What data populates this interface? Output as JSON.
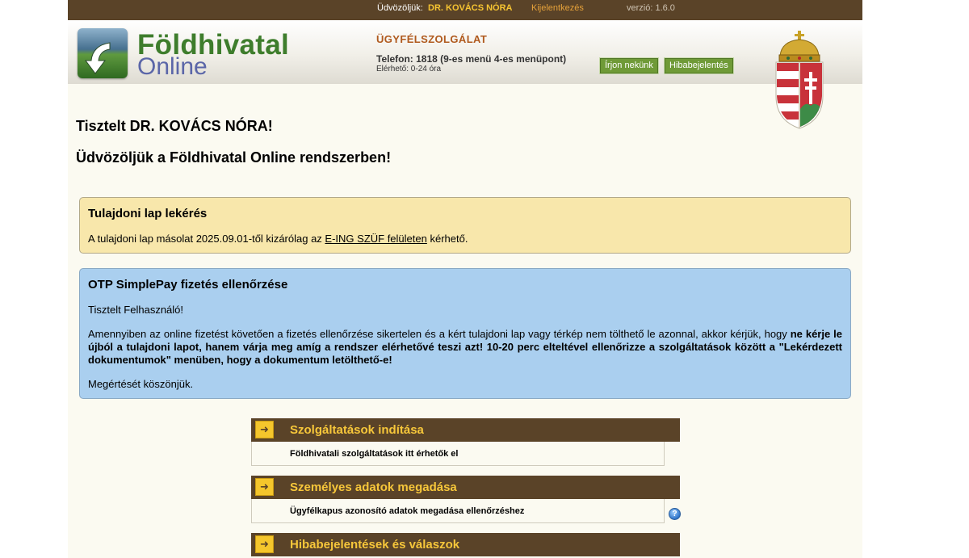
{
  "topbar": {
    "welcome_label": "Üdvözöljük:",
    "user_name": "DR. KOVÁCS NÓRA",
    "logout_label": "Kijelentkezés",
    "version": "verzió: 1.6.0"
  },
  "header": {
    "logo_title": "Földhivatal",
    "logo_subtitle": "Online",
    "service_title": "ÜGYFÉLSZOLGÁLAT",
    "phone": "Telefon: 1818 (9-es menü 4-es menüpont)",
    "availability": "Elérhető: 0-24 óra",
    "write_us_label": "Írjon nekünk",
    "bug_report_label": "Hibabejelentés"
  },
  "greeting": {
    "line1": "Tisztelt DR. KOVÁCS NÓRA!",
    "line2": "Üdvözöljük a Földhivatal Online rendszerben!"
  },
  "notice_property": {
    "title": "Tulajdoni lap lekérés",
    "text_before": "A tulajdoni lap másolat 2025.09.01-től kizárólag az ",
    "link": "E-ING SZÜF felületen",
    "text_after": " kérhető."
  },
  "notice_payment": {
    "title": "OTP SimplePay fizetés ellenőrzése",
    "salutation": "Tisztelt Felhasználó!",
    "body_normal": "Amennyiben az online fizetést követően a fizetés ellenőrzése sikertelen és a kért tulajdoni lap vagy térkép nem tölthető le azonnal, akkor kérjük, hogy ",
    "body_bold": "ne kérje le újból a tulajdoni lapot, hanem várja meg amíg a rendszer elérhetővé teszi azt! 10-20 perc elteltével ellenőrizze a szolgáltatások között a \"Lekérdezett dokumentumok\" menüben, hogy a dokumentum letölthető-e!",
    "closing": "Megértését köszönjük."
  },
  "menu": [
    {
      "title": "Szolgáltatások indítása",
      "description": "Földhivatali szolgáltatások itt érhetők el"
    },
    {
      "title": "Személyes adatok megadása",
      "description": "Ügyfélkapus azonosító adatok megadása ellenőrzéshez"
    },
    {
      "title": "Hibabejelentések és válaszok",
      "description": ""
    }
  ],
  "colors": {
    "brand_brown": "#5a4328",
    "accent_yellow": "#f7c73a",
    "logo_green": "#3e7d2c",
    "notice_yellow": "#f8e7ab",
    "notice_blue": "#aacfef"
  }
}
